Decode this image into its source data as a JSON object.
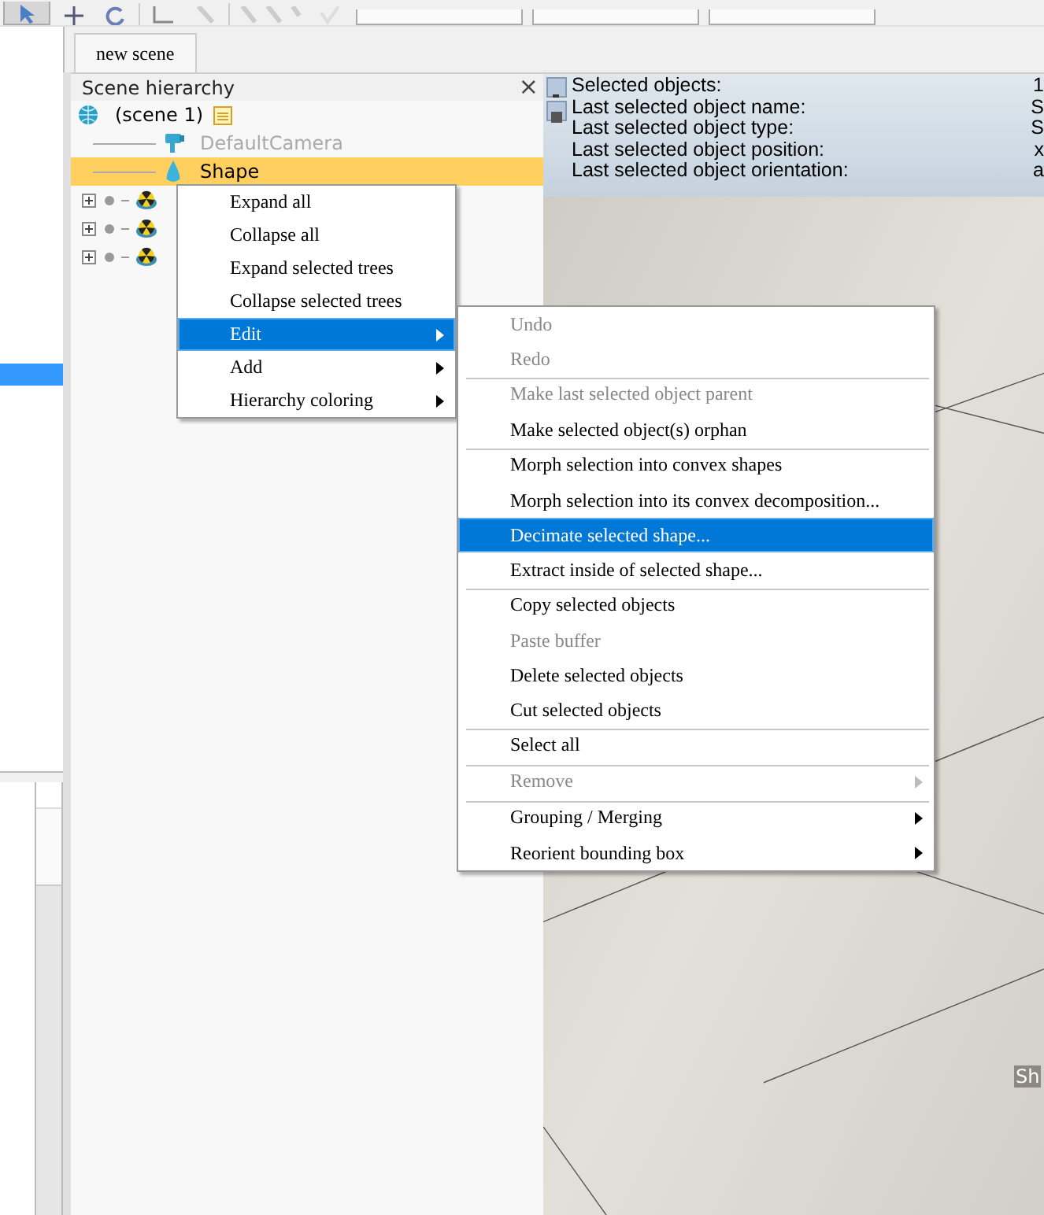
{
  "tabs": [
    {
      "label": "new scene",
      "selected": true
    }
  ],
  "model_browser": {
    "rows": [
      {
        "selected": true
      }
    ]
  },
  "hierarchy": {
    "title": "Scene hierarchy",
    "close": "×",
    "nodes": [
      {
        "label": "(scene 1)",
        "kind": "scene",
        "selected": false,
        "dimmed": false,
        "expanded": true,
        "children": [
          {
            "label": "DefaultCamera",
            "kind": "camera",
            "selected": false,
            "dimmed": true
          },
          {
            "label": "Shape",
            "kind": "shape",
            "selected": true,
            "dimmed": false
          },
          {
            "kind": "dummy",
            "selected": false,
            "expanded": false
          },
          {
            "kind": "dummy",
            "selected": false,
            "expanded": false
          },
          {
            "kind": "dummy",
            "selected": false,
            "expanded": false
          }
        ]
      }
    ]
  },
  "info": {
    "toggles": [
      {
        "kind": "minus"
      },
      {
        "kind": "square"
      }
    ],
    "rows": [
      {
        "label": "Selected objects:",
        "value": "1"
      },
      {
        "label": "Last selected object name:",
        "value": "S"
      },
      {
        "label": "Last selected object type:",
        "value": "S"
      },
      {
        "label": "Last selected object position:",
        "value": "x"
      },
      {
        "label": "Last selected object orientation:",
        "value": "a"
      }
    ]
  },
  "viewport": {
    "object_label": "Sh"
  },
  "context_menu": {
    "items": [
      {
        "label": "Expand all",
        "selected": false,
        "submenu": false
      },
      {
        "label": "Collapse all",
        "selected": false,
        "submenu": false
      },
      {
        "label": "Expand selected trees",
        "selected": false,
        "submenu": false
      },
      {
        "label": "Collapse selected trees",
        "selected": false,
        "submenu": false
      },
      {
        "label": "Edit",
        "selected": true,
        "submenu": true
      },
      {
        "label": "Add",
        "selected": false,
        "submenu": true
      },
      {
        "label": "Hierarchy coloring",
        "selected": false,
        "submenu": true
      }
    ]
  },
  "submenu": {
    "items": [
      {
        "label": "Undo",
        "disabled": true,
        "selected": false,
        "submenu": false,
        "separator_before": false
      },
      {
        "label": "Redo",
        "disabled": true,
        "selected": false,
        "submenu": false,
        "separator_before": false
      },
      {
        "label": "Make last selected object parent",
        "disabled": true,
        "selected": false,
        "submenu": false,
        "separator_before": true
      },
      {
        "label": "Make selected object(s) orphan",
        "disabled": false,
        "selected": false,
        "submenu": false,
        "separator_before": false
      },
      {
        "label": "Morph selection into convex shapes",
        "disabled": false,
        "selected": false,
        "submenu": false,
        "separator_before": true
      },
      {
        "label": "Morph selection into its convex decomposition...",
        "disabled": false,
        "selected": false,
        "submenu": false,
        "separator_before": false
      },
      {
        "label": "Decimate selected shape...",
        "disabled": false,
        "selected": true,
        "submenu": false,
        "separator_before": false
      },
      {
        "label": "Extract inside of selected shape...",
        "disabled": false,
        "selected": false,
        "submenu": false,
        "separator_before": false
      },
      {
        "label": "Copy selected objects",
        "disabled": false,
        "selected": false,
        "submenu": false,
        "separator_before": true
      },
      {
        "label": "Paste buffer",
        "disabled": true,
        "selected": false,
        "submenu": false,
        "separator_before": false
      },
      {
        "label": "Delete selected objects",
        "disabled": false,
        "selected": false,
        "submenu": false,
        "separator_before": false
      },
      {
        "label": "Cut selected objects",
        "disabled": false,
        "selected": false,
        "submenu": false,
        "separator_before": false
      },
      {
        "label": "Select all",
        "disabled": false,
        "selected": false,
        "submenu": false,
        "separator_before": true
      },
      {
        "label": "Remove",
        "disabled": true,
        "selected": false,
        "submenu": true,
        "separator_before": true
      },
      {
        "label": "Grouping / Merging",
        "disabled": false,
        "selected": false,
        "submenu": true,
        "separator_before": true
      },
      {
        "label": "Reorient bounding box",
        "disabled": false,
        "selected": false,
        "submenu": true,
        "separator_before": false
      }
    ]
  }
}
